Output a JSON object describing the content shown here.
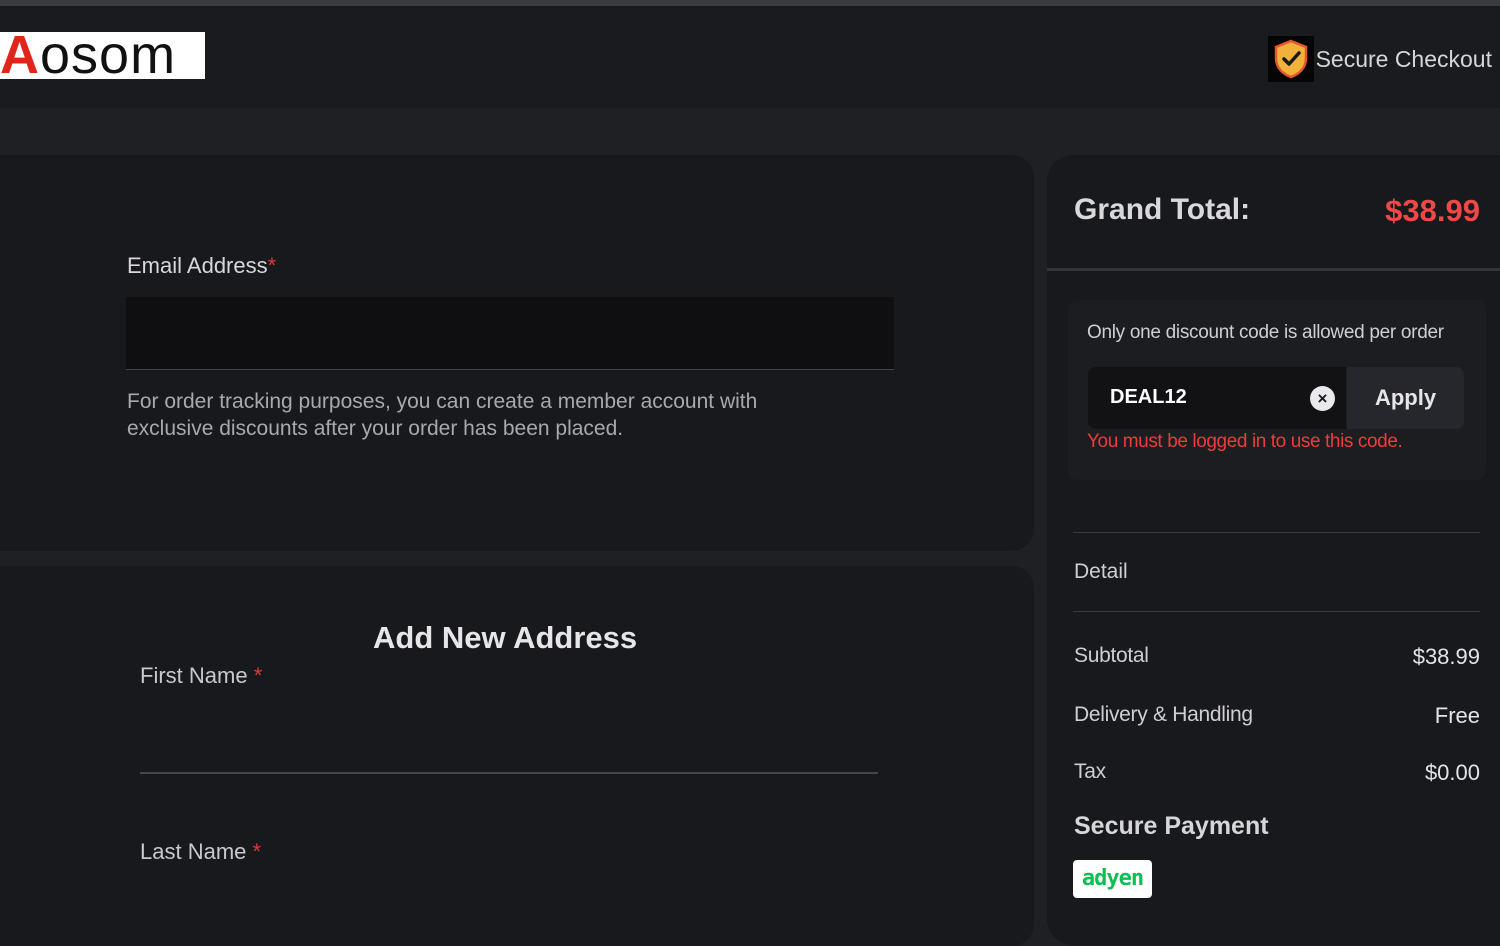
{
  "header": {
    "logo_first": "A",
    "logo_rest": "osom",
    "secure_checkout": "Secure Checkout"
  },
  "email": {
    "label": "Email Address",
    "required_mark": "*",
    "value": "",
    "help": "For order tracking purposes, you can create a member account with exclusive discounts after your order has been placed."
  },
  "address": {
    "title": "Add New Address",
    "first_name_label": "First Name",
    "last_name_label": "Last Name",
    "required_mark": "*"
  },
  "summary": {
    "grand_total_label": "Grand Total:",
    "grand_total_value": "$38.99",
    "discount_note": "Only one discount code is allowed per order",
    "discount_code": "DEAL12",
    "apply_label": "Apply",
    "discount_error": "You must be logged in to use this code.",
    "detail_label": "Detail",
    "rows": [
      {
        "label": "Subtotal",
        "value": "$38.99"
      },
      {
        "label": "Delivery & Handling",
        "value": "Free"
      },
      {
        "label": "Tax",
        "value": "$0.00"
      }
    ],
    "secure_payment_label": "Secure Payment",
    "payment_logo": "adyen"
  },
  "colors": {
    "accent_red": "#f04848",
    "payment_green": "#0abf53"
  }
}
